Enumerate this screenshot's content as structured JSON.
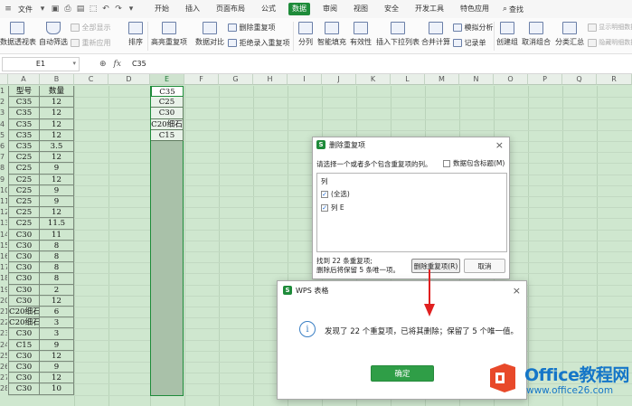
{
  "menubar": {
    "file": "文件",
    "tabs": [
      {
        "label": "开始",
        "active": false
      },
      {
        "label": "插入",
        "active": false
      },
      {
        "label": "页面布局",
        "active": false
      },
      {
        "label": "公式",
        "active": false
      },
      {
        "label": "数据",
        "active": true
      },
      {
        "label": "审阅",
        "active": false
      },
      {
        "label": "视图",
        "active": false
      },
      {
        "label": "安全",
        "active": false
      },
      {
        "label": "开发工具",
        "active": false
      },
      {
        "label": "特色应用",
        "active": false
      }
    ],
    "search": "查找"
  },
  "ribbon": {
    "pivot": "数据透视表",
    "autofilter": "自动筛选",
    "show_all": "全部显示",
    "reapply": "重新应用",
    "sort": "排序",
    "highlight_dup": "高亮重复项",
    "compare": "数据对比",
    "remove_dup": "删除重复项",
    "reject_dup": "拒绝录入重复项",
    "split": "分列",
    "smart_fill": "智能填充",
    "validity": "有效性",
    "dropdown_list": "插入下拉列表",
    "consolidate": "合并计算",
    "simulate": "模拟分析",
    "record": "记录单",
    "create_group": "创建组",
    "ungroup": "取消组合",
    "subtotal": "分类汇总",
    "show_detail": "显示明细数据",
    "hide_detail": "隐藏明细数据"
  },
  "formula_bar": {
    "name_box": "E1",
    "value": "C35"
  },
  "sheet": {
    "columns": [
      "A",
      "B",
      "C",
      "D",
      "E",
      "F",
      "G",
      "H",
      "I",
      "J",
      "K",
      "L",
      "M",
      "N",
      "O",
      "P",
      "Q",
      "R"
    ],
    "row_numbers": [
      "1",
      "2",
      "3",
      "4",
      "5",
      "6",
      "7",
      "8",
      "9",
      "10",
      "11",
      "12",
      "13",
      "14",
      "15",
      "16",
      "17",
      "18",
      "19",
      "20",
      "21",
      "22",
      "23",
      "24",
      "25",
      "26",
      "27",
      "28"
    ],
    "rows": [
      [
        "型号",
        "数量"
      ],
      [
        "C35",
        "12"
      ],
      [
        "C35",
        "12"
      ],
      [
        "C35",
        "12"
      ],
      [
        "C35",
        "12"
      ],
      [
        "C35",
        "3.5"
      ],
      [
        "C25",
        "12"
      ],
      [
        "C25",
        "9"
      ],
      [
        "C25",
        "12"
      ],
      [
        "C25",
        "9"
      ],
      [
        "C25",
        "9"
      ],
      [
        "C25",
        "12"
      ],
      [
        "C25",
        "11.5"
      ],
      [
        "C30",
        "11"
      ],
      [
        "C30",
        "8"
      ],
      [
        "C30",
        "8"
      ],
      [
        "C30",
        "8"
      ],
      [
        "C30",
        "8"
      ],
      [
        "C30",
        "2"
      ],
      [
        "C30",
        "12"
      ],
      [
        "C20细石",
        "6"
      ],
      [
        "C20细石",
        "3"
      ],
      [
        "C30",
        "3"
      ],
      [
        "C15",
        "9"
      ],
      [
        "C30",
        "12"
      ],
      [
        "C30",
        "9"
      ],
      [
        "C30",
        "12"
      ],
      [
        "C30",
        "10"
      ]
    ],
    "column_e": [
      "C35",
      "C25",
      "C30",
      "C20细石",
      "C15"
    ]
  },
  "remove_dup_dialog": {
    "title": "删除重复项",
    "prompt": "请选择一个或者多个包含重复项的列。",
    "header_check": "数据包含标题(M)",
    "list_header": "列",
    "select_all": "(全选)",
    "col_e": "列 E",
    "found": "找到 22 条重复项;",
    "keep": "删除后将保留 5 条唯一项。",
    "delete_button": "删除重复项(R)",
    "cancel_button": "取消"
  },
  "wps_dialog": {
    "title": "WPS 表格",
    "message": "发现了 22 个重复项，已将其删除；保留了 5 个唯一值。",
    "ok_button": "确定"
  },
  "watermark": {
    "brand": "Office教程网",
    "url": "www.office26.com"
  },
  "colors": {
    "accent": "#1e8b3a",
    "sheet_bg": "#cfe7cf",
    "watermark": "#1576c8",
    "arrow": "#e02020"
  }
}
